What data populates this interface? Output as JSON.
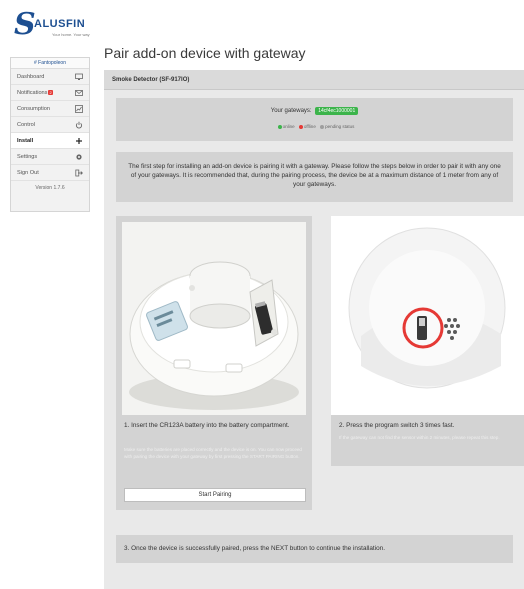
{
  "brand": {
    "logo_s": "S",
    "logo_word": "ALUSFIN",
    "logo_tagline": "Your home. Your way"
  },
  "sidebar": {
    "user": "# Fantopoleon",
    "items": [
      {
        "label": "Dashboard",
        "icon": "monitor-icon"
      },
      {
        "label": "Notifications",
        "icon": "envelope-icon",
        "badge": "2"
      },
      {
        "label": "Consumption",
        "icon": "chart-icon"
      },
      {
        "label": "Control",
        "icon": "power-icon"
      },
      {
        "label": "Install",
        "icon": "plus-icon",
        "active": true
      },
      {
        "label": "Settings",
        "icon": "gear-icon"
      },
      {
        "label": "Sign Out",
        "icon": "sign-out-icon"
      }
    ],
    "version": "Version 1.7.6"
  },
  "page": {
    "title": "Pair add-on device with gateway",
    "device_header": "Smoke Detector (SF-917IO)"
  },
  "gateways": {
    "label": "Your gateways:",
    "id": "14cf4ec1000001",
    "legend": [
      {
        "label": "online",
        "color": "#3cb44b"
      },
      {
        "label": "offline",
        "color": "#e53935"
      },
      {
        "label": "pending status",
        "color": "#9e9e9e"
      }
    ]
  },
  "intro": "The first step for installing an add-on device is pairing it with a gateway. Please follow the steps below in order to pair it with any one of your gateways. It is recommended that, during the pairing process, the device be at a maximum distance of 1 meter from any of your gateways.",
  "steps": {
    "step1": {
      "title": "1. Insert the CR123A battery into the battery compartment.",
      "note": "Make sure the batteries are placed correctly and the device is on. You can now proceed with pairing the device with your gateway by first pressing the START PAIRING button.",
      "button": "Start Pairing"
    },
    "step2": {
      "title": "2. Press the program switch 3 times fast.",
      "note": "If the gateway can not find the sensor within 2 minutes, please repeat this step."
    },
    "step3": {
      "title": "3. Once the device is successfully paired, press the NEXT button to continue the installation."
    }
  },
  "colors": {
    "brand": "#1d4f91",
    "online": "#3cb44b",
    "highlight": "#e53935"
  }
}
